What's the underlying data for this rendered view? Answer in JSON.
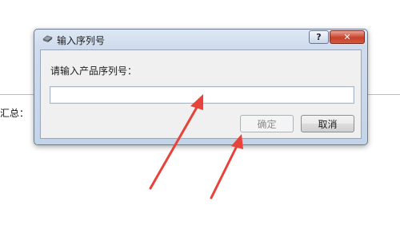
{
  "background": {
    "label": "汇总："
  },
  "dialog": {
    "title": "输入序列号",
    "app_icon": "disk-drive-icon",
    "help_label": "?",
    "close_label": "✕",
    "prompt": "请输入产品序列号：",
    "serial_input": {
      "value": "",
      "placeholder": ""
    },
    "ok_label": "确定",
    "cancel_label": "取消"
  },
  "annotations": {
    "arrow_color": "#e8433b"
  }
}
